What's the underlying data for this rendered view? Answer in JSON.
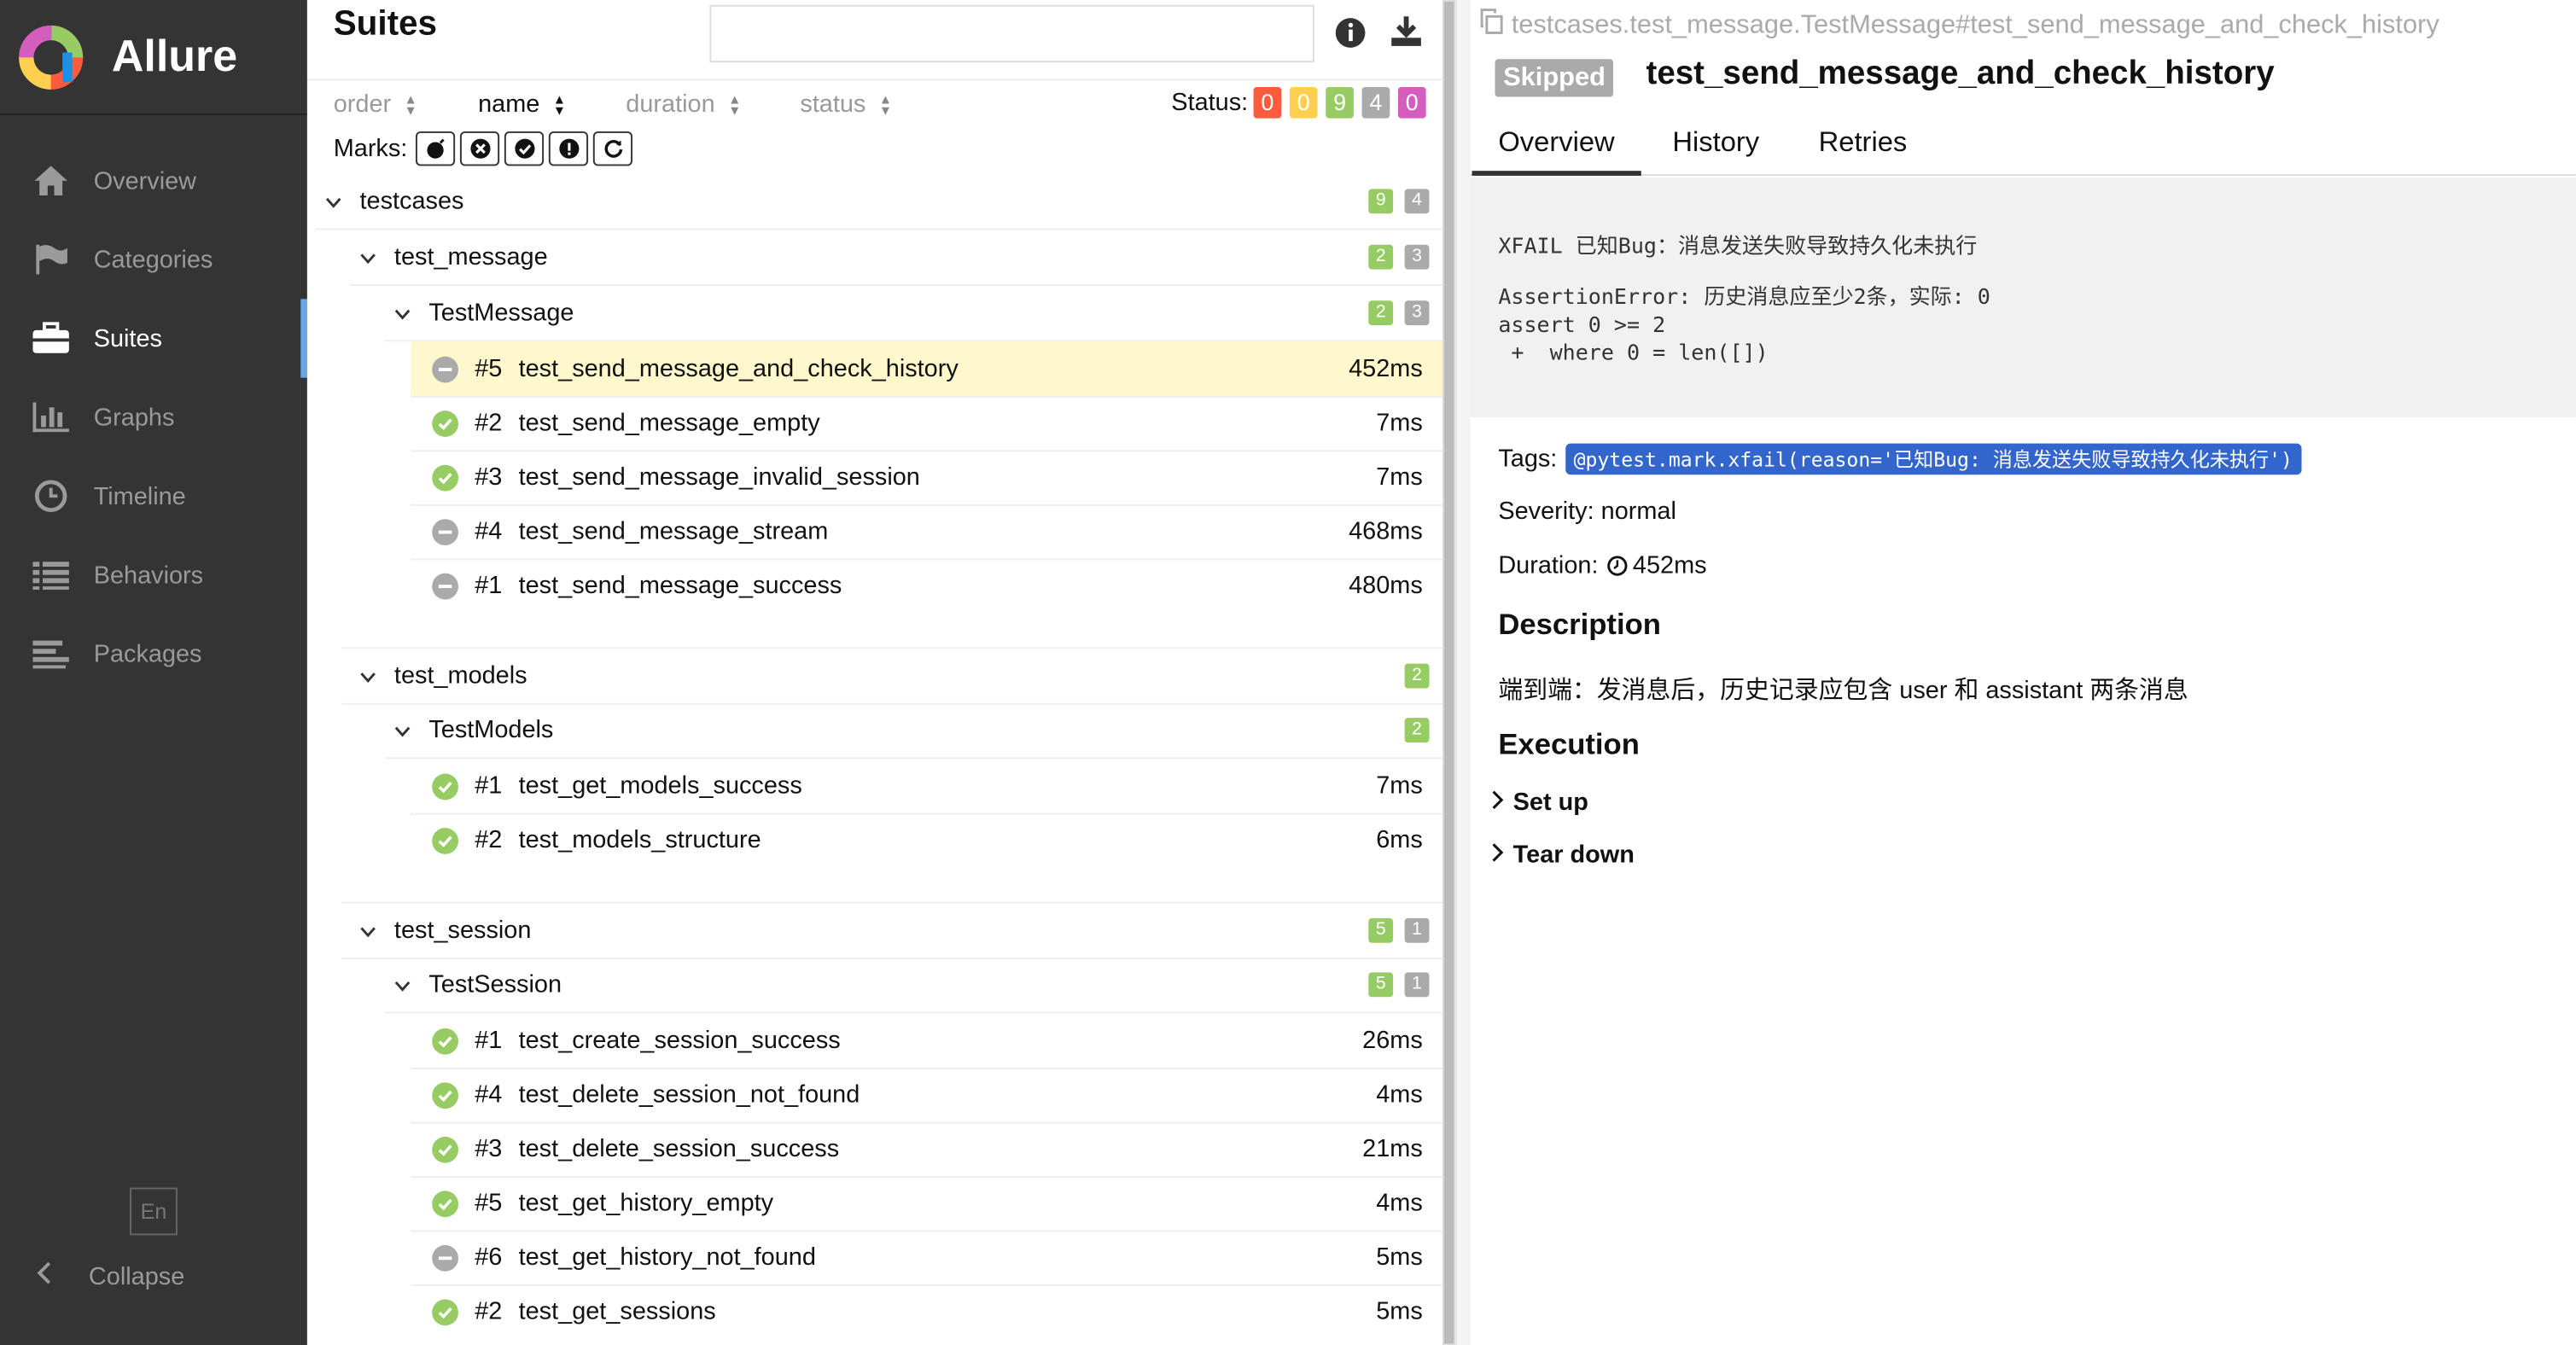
{
  "app": {
    "title": "Allure"
  },
  "sidebar": {
    "items": [
      {
        "label": "Overview",
        "icon": "home-icon"
      },
      {
        "label": "Categories",
        "icon": "flag-icon"
      },
      {
        "label": "Suites",
        "icon": "briefcase-icon"
      },
      {
        "label": "Graphs",
        "icon": "bar-chart-icon"
      },
      {
        "label": "Timeline",
        "icon": "clock-icon"
      },
      {
        "label": "Behaviors",
        "icon": "list-icon"
      },
      {
        "label": "Packages",
        "icon": "align-left-icon"
      }
    ],
    "active": "Suites",
    "language": "En",
    "collapse_label": "Collapse"
  },
  "tree": {
    "title": "Suites",
    "search_value": "",
    "sort": {
      "order": "order",
      "name": "name",
      "duration": "duration",
      "status": "status"
    },
    "status_label": "Status:",
    "status_counts": [
      {
        "value": "0",
        "color": "#fd5a3e"
      },
      {
        "value": "0",
        "color": "#ffd050"
      },
      {
        "value": "9",
        "color": "#97cc64"
      },
      {
        "value": "4",
        "color": "#aaaaaa"
      },
      {
        "value": "0",
        "color": "#d35ebe"
      }
    ],
    "marks_label": "Marks:",
    "groups": {
      "root": {
        "name": "testcases",
        "counts": [
          "9",
          "4"
        ]
      },
      "message": {
        "name": "test_message",
        "counts": [
          "2",
          "3"
        ]
      },
      "message_class": {
        "name": "TestMessage",
        "counts": [
          "2",
          "3"
        ]
      },
      "models": {
        "name": "test_models",
        "counts": [
          "2"
        ]
      },
      "models_class": {
        "name": "TestModels",
        "counts": [
          "2"
        ]
      },
      "session": {
        "name": "test_session",
        "counts": [
          "5",
          "1"
        ]
      },
      "session_class": {
        "name": "TestSession",
        "counts": [
          "5",
          "1"
        ]
      }
    },
    "message_tests": [
      {
        "num": "#5",
        "name": "test_send_message_and_check_history",
        "duration": "452ms",
        "status": "skipped"
      },
      {
        "num": "#2",
        "name": "test_send_message_empty",
        "duration": "7ms",
        "status": "passed"
      },
      {
        "num": "#3",
        "name": "test_send_message_invalid_session",
        "duration": "7ms",
        "status": "passed"
      },
      {
        "num": "#4",
        "name": "test_send_message_stream",
        "duration": "468ms",
        "status": "skipped"
      },
      {
        "num": "#1",
        "name": "test_send_message_success",
        "duration": "480ms",
        "status": "skipped"
      }
    ],
    "models_tests": [
      {
        "num": "#1",
        "name": "test_get_models_success",
        "duration": "7ms",
        "status": "passed"
      },
      {
        "num": "#2",
        "name": "test_models_structure",
        "duration": "6ms",
        "status": "passed"
      }
    ],
    "session_tests": [
      {
        "num": "#1",
        "name": "test_create_session_success",
        "duration": "26ms",
        "status": "passed"
      },
      {
        "num": "#4",
        "name": "test_delete_session_not_found",
        "duration": "4ms",
        "status": "passed"
      },
      {
        "num": "#3",
        "name": "test_delete_session_success",
        "duration": "21ms",
        "status": "passed"
      },
      {
        "num": "#5",
        "name": "test_get_history_empty",
        "duration": "4ms",
        "status": "passed"
      },
      {
        "num": "#6",
        "name": "test_get_history_not_found",
        "duration": "5ms",
        "status": "skipped"
      },
      {
        "num": "#2",
        "name": "test_get_sessions",
        "duration": "5ms",
        "status": "passed"
      }
    ]
  },
  "detail": {
    "path": "testcases.test_message.TestMessage#test_send_message_and_check_history",
    "status": "Skipped",
    "title": "test_send_message_and_check_history",
    "tabs": [
      "Overview",
      "History",
      "Retries"
    ],
    "error_line1": "XFAIL 已知Bug：消息发送失败导致持久化未执行",
    "error_line2": "AssertionError: 历史消息应至少2条，实际: 0\nassert 0 >= 2\n +  where 0 = len([])",
    "tags_label": "Tags:",
    "tag": "@pytest.mark.xfail(reason='已知Bug: 消息发送失败导致持久化未执行')",
    "severity": "Severity: normal",
    "duration_label": "Duration:",
    "duration": "452ms",
    "description_heading": "Description",
    "description": "端到端：发消息后，历史记录应包含 user 和 assistant 两条消息",
    "execution_heading": "Execution",
    "setup": "Set up",
    "teardown": "Tear down"
  }
}
